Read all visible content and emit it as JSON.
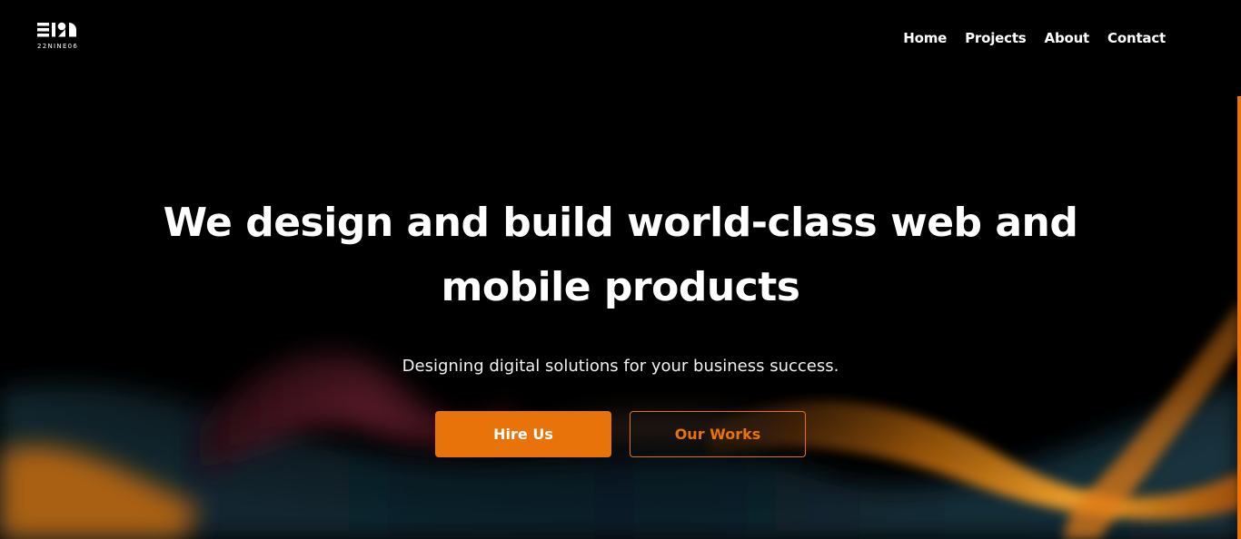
{
  "brand": {
    "logo_text": "22NINE06",
    "accent_color": "#e8730a"
  },
  "nav": {
    "items": [
      {
        "label": "Home"
      },
      {
        "label": "Projects"
      },
      {
        "label": "About"
      },
      {
        "label": "Contact"
      }
    ]
  },
  "hero": {
    "headline_line1": "We design and build world-class web and",
    "headline_line2": "mobile products",
    "subheadline": "Designing digital solutions for your business success.",
    "primary_cta": "Hire Us",
    "secondary_cta": "Our Works"
  }
}
